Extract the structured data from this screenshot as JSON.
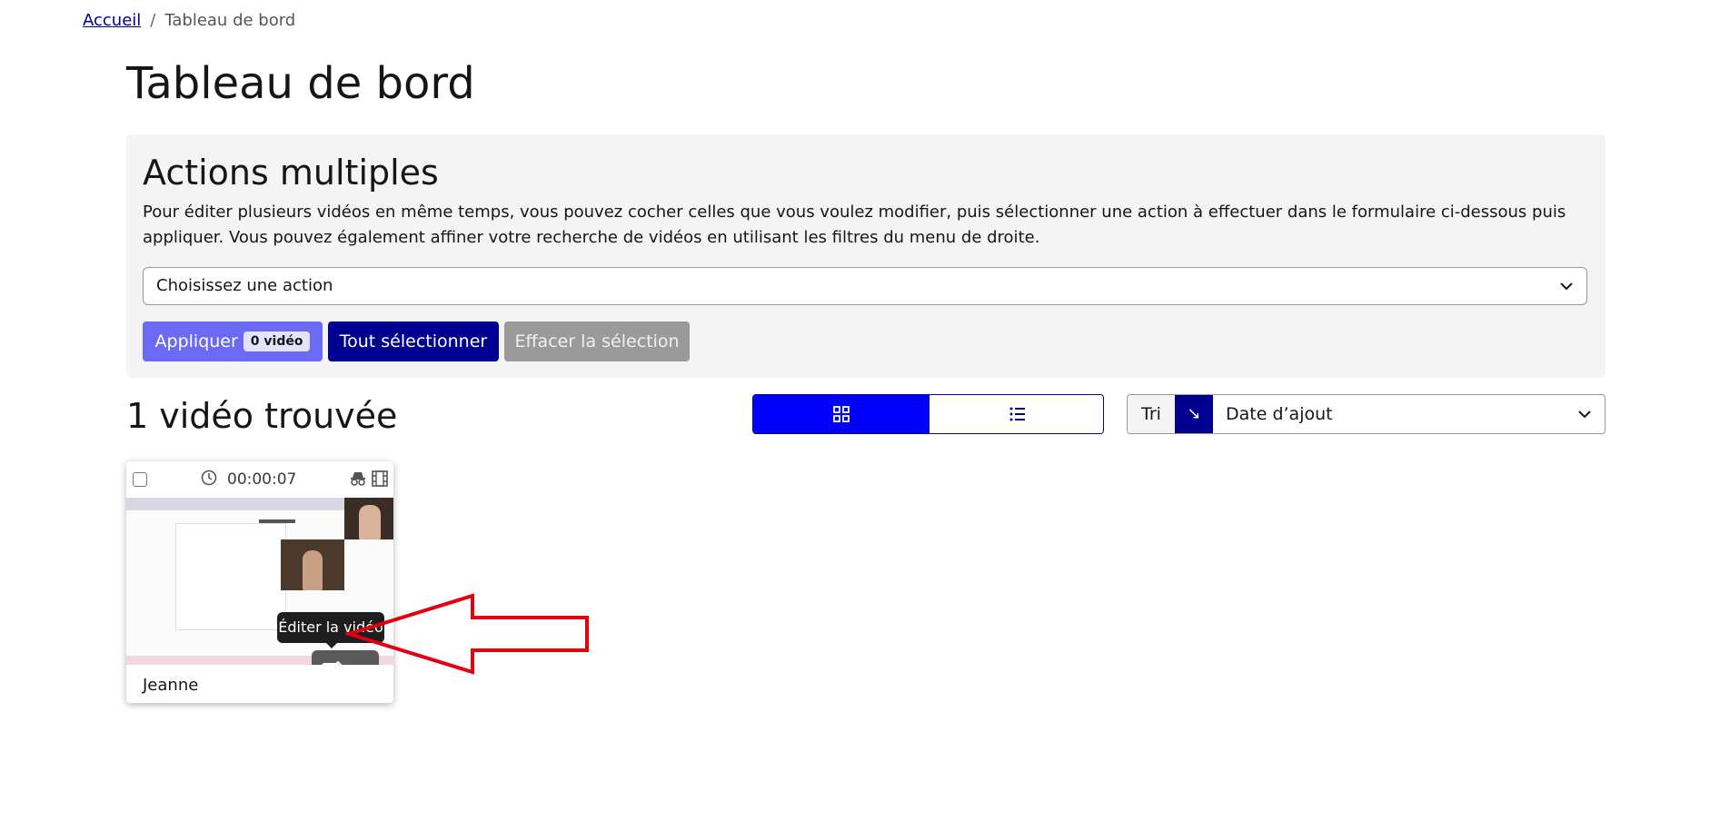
{
  "breadcrumb": {
    "home": "Accueil",
    "separator": "/",
    "current": "Tableau de bord"
  },
  "page_title": "Tableau de bord",
  "bulk_actions": {
    "title": "Actions multiples",
    "description": "Pour éditer plusieurs vidéos en même temps, vous pouvez cocher celles que vous voulez modifier, puis sélectionner une action à effectuer dans le formulaire ci-dessous puis appliquer. Vous pouvez également affiner votre recherche de vidéos en utilisant les filtres du menu de droite.",
    "select_placeholder": "Choisissez une action",
    "apply_label": "Appliquer",
    "apply_badge": "0 vidéo",
    "select_all_label": "Tout sélectionner",
    "clear_label": "Effacer la sélection"
  },
  "results": {
    "title": "1 vidéo trouvée",
    "view_modes": [
      "grid-icon",
      "list-icon"
    ],
    "active_view": "grid"
  },
  "sort": {
    "label": "Tri",
    "direction": "↘",
    "value": "Date d’ajout"
  },
  "videos": [
    {
      "title": "Jeanne",
      "duration": "00:00:07",
      "tooltip": "Éditer la vidéo",
      "icons": [
        "clock-icon",
        "spy-icon",
        "film-icon",
        "edit-icon",
        "delete-icon"
      ]
    }
  ],
  "colors": {
    "primary": "#000091",
    "apply": "#6a6af4",
    "active_toggle": "#0000ff",
    "disabled": "#9a9a9a",
    "panel_bg": "#f4f4f4",
    "annotation_arrow": "#e1000f"
  }
}
